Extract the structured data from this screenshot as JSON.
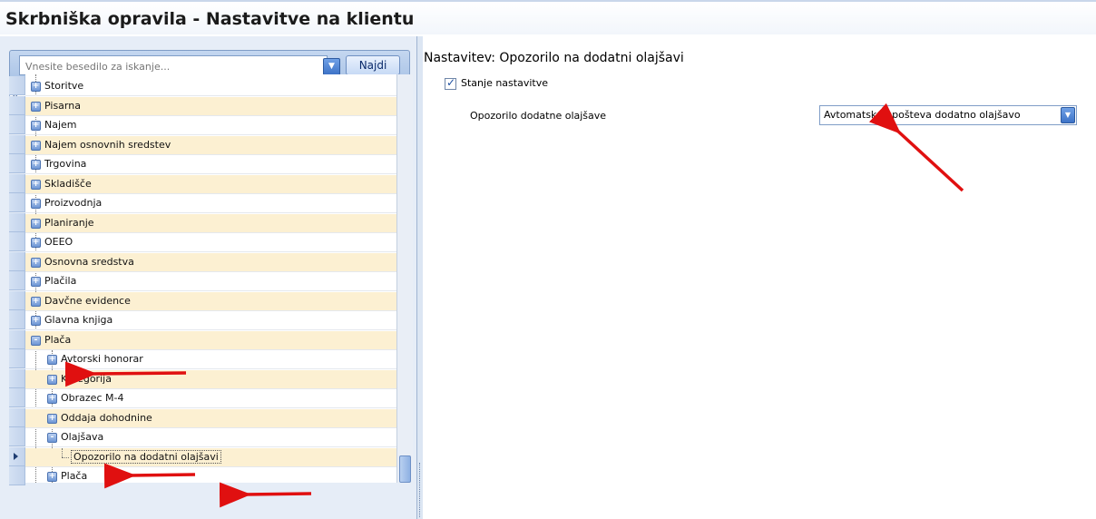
{
  "page_title": "Skrbniška opravila - Nastavitve na klientu",
  "search": {
    "placeholder": "Vnesite besedilo za iskanje...",
    "find_label": "Najdi"
  },
  "tree": {
    "items": [
      {
        "label": "Storitve",
        "level": 0,
        "expander": "+"
      },
      {
        "label": "Pisarna",
        "level": 0,
        "expander": "+"
      },
      {
        "label": "Najem",
        "level": 0,
        "expander": "+"
      },
      {
        "label": "Najem osnovnih sredstev",
        "level": 0,
        "expander": "+"
      },
      {
        "label": "Trgovina",
        "level": 0,
        "expander": "+"
      },
      {
        "label": "Skladišče",
        "level": 0,
        "expander": "+"
      },
      {
        "label": "Proizvodnja",
        "level": 0,
        "expander": "+"
      },
      {
        "label": "Planiranje",
        "level": 0,
        "expander": "+"
      },
      {
        "label": "OEEO",
        "level": 0,
        "expander": "+"
      },
      {
        "label": "Osnovna sredstva",
        "level": 0,
        "expander": "+"
      },
      {
        "label": "Plačila",
        "level": 0,
        "expander": "+"
      },
      {
        "label": "Davčne evidence",
        "level": 0,
        "expander": "+"
      },
      {
        "label": "Glavna knjiga",
        "level": 0,
        "expander": "+"
      },
      {
        "label": "Plača",
        "level": 0,
        "expander": "-"
      },
      {
        "label": "Avtorski honorar",
        "level": 1,
        "expander": "+"
      },
      {
        "label": "Kategorija",
        "level": 1,
        "expander": "+"
      },
      {
        "label": "Obrazec M-4",
        "level": 1,
        "expander": "+"
      },
      {
        "label": "Oddaja dohodnine",
        "level": 1,
        "expander": "+"
      },
      {
        "label": "Olajšava",
        "level": 1,
        "expander": "-"
      },
      {
        "label": "Opozorilo na dodatni olajšavi",
        "level": 2,
        "expander": ""
      },
      {
        "label": "Plača",
        "level": 1,
        "expander": "+"
      }
    ]
  },
  "settings": {
    "heading": "Nastavitev: Opozorilo na dodatni olajšavi",
    "state_label": "Stanje nastavitve",
    "state_checked": true,
    "setting_label": "Opozorilo dodatne olajšave",
    "setting_value": "Avtomatsko upošteva dodatno olajšavo"
  },
  "colors": {
    "alt_row": "#fcf0d2",
    "arrow": "#e01010",
    "accent": "#3d73c7"
  },
  "icons": {
    "filter": "filter-icon",
    "dropdown": "chevron-down-icon",
    "scroll_up": "chevron-up-icon",
    "row_indicator": "row-pointer-icon"
  }
}
